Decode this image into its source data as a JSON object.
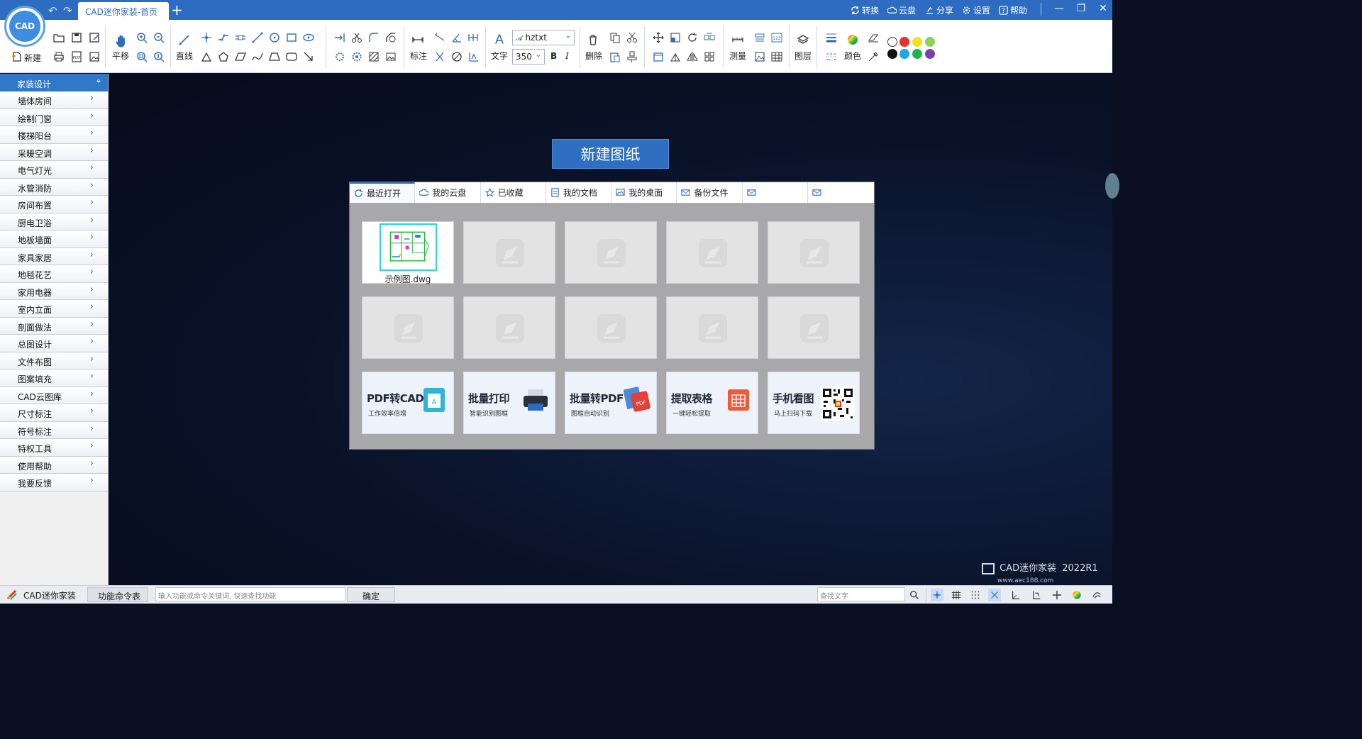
{
  "window": {
    "tab_title": "CAD迷你家装-首页",
    "logo_text": "CAD",
    "top_links": [
      "转换",
      "云盘",
      "分享",
      "设置",
      "帮助"
    ]
  },
  "ribbon": {
    "new_label": "新建",
    "pan_label": "平移",
    "line_label": "直线",
    "dim_label": "标注",
    "text_label": "文字",
    "font_value": "hztxt",
    "size_value": "350",
    "bold": "B",
    "italic": "I",
    "delete_label": "删除",
    "measure_label": "测量",
    "layer_label": "图层",
    "color_label": "颜色",
    "swatches": [
      "#ffffff",
      "#e8322a",
      "#f5e11b",
      "#8bd15a",
      "#111111",
      "#19a8e6",
      "#1fb34d",
      "#7a3fb0"
    ]
  },
  "sidebar": {
    "header": "家装设计",
    "items": [
      "墙体房间",
      "绘制门窗",
      "楼梯阳台",
      "采暖空调",
      "电气灯光",
      "水管消防",
      "房间布置",
      "厨电卫浴",
      "地板墙面",
      "家具家居",
      "地毯花艺",
      "家用电器",
      "室内立面",
      "剖面做法",
      "总图设计",
      "文件布图",
      "图案填充",
      "CAD云图库",
      "尺寸标注",
      "符号标注",
      "特权工具",
      "使用帮助",
      "我要反馈"
    ]
  },
  "main": {
    "new_drawing": "新建图纸",
    "tabs": [
      "最近打开",
      "我的云盘",
      "已收藏",
      "我的文档",
      "我的桌面",
      "备份文件",
      "",
      ""
    ],
    "recent_file": "示例图.dwg",
    "promos": [
      {
        "title": "PDF转CAD",
        "sub": "工作效率倍增"
      },
      {
        "title": "批量打印",
        "sub": "智能识别图框"
      },
      {
        "title": "批量转PDF",
        "sub": "图框自动识别"
      },
      {
        "title": "提取表格",
        "sub": "一键轻松提取"
      },
      {
        "title": "手机看图",
        "sub": "马上扫码下载"
      }
    ],
    "brand": "CAD迷你家装",
    "version": "2022R1",
    "brand_url": "www.aec188.com"
  },
  "status": {
    "app_name": "CAD迷你家装",
    "cmd_table": "功能命令表",
    "cmd_placeholder": "输入功能或命令关键词, 快速查找功能",
    "ok": "确定",
    "search_placeholder": "查找文字"
  }
}
